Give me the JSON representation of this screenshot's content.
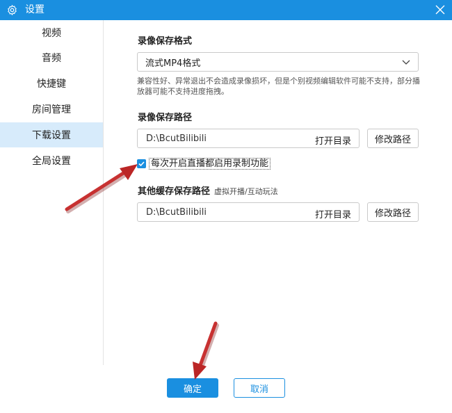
{
  "window": {
    "title": "设置",
    "icons": {
      "settings": "gear-icon",
      "close": "close-icon"
    },
    "accent_color": "#1a8fe0"
  },
  "sidebar": {
    "items": [
      {
        "label": "视频",
        "active": false
      },
      {
        "label": "音频",
        "active": false
      },
      {
        "label": "快捷键",
        "active": false
      },
      {
        "label": "房间管理",
        "active": false
      },
      {
        "label": "下载设置",
        "active": true
      },
      {
        "label": "全局设置",
        "active": false
      }
    ],
    "active_bg": "#d7ebfb"
  },
  "recording_format": {
    "label": "录像保存格式",
    "selected": "流式MP4格式",
    "hint": "兼容性好、异常退出不会造成录像损坏，但是个别视频编辑软件可能不支持，部分播放器可能不支持进度拖拽。"
  },
  "recording_path": {
    "label": "录像保存路径",
    "path": "D:\\BcutBilibili",
    "open_label": "打开目录",
    "change_label": "修改路径"
  },
  "auto_record": {
    "checked": true,
    "label": "每次开启直播都启用录制功能"
  },
  "cache_path": {
    "label": "其他缓存保存路径",
    "sublabel": "虚拟开播/互动玩法",
    "path": "D:\\BcutBilibili",
    "open_label": "打开目录",
    "change_label": "修改路径"
  },
  "footer": {
    "ok_label": "确定",
    "cancel_label": "取消"
  },
  "annotation_color": "#cc1f1f"
}
